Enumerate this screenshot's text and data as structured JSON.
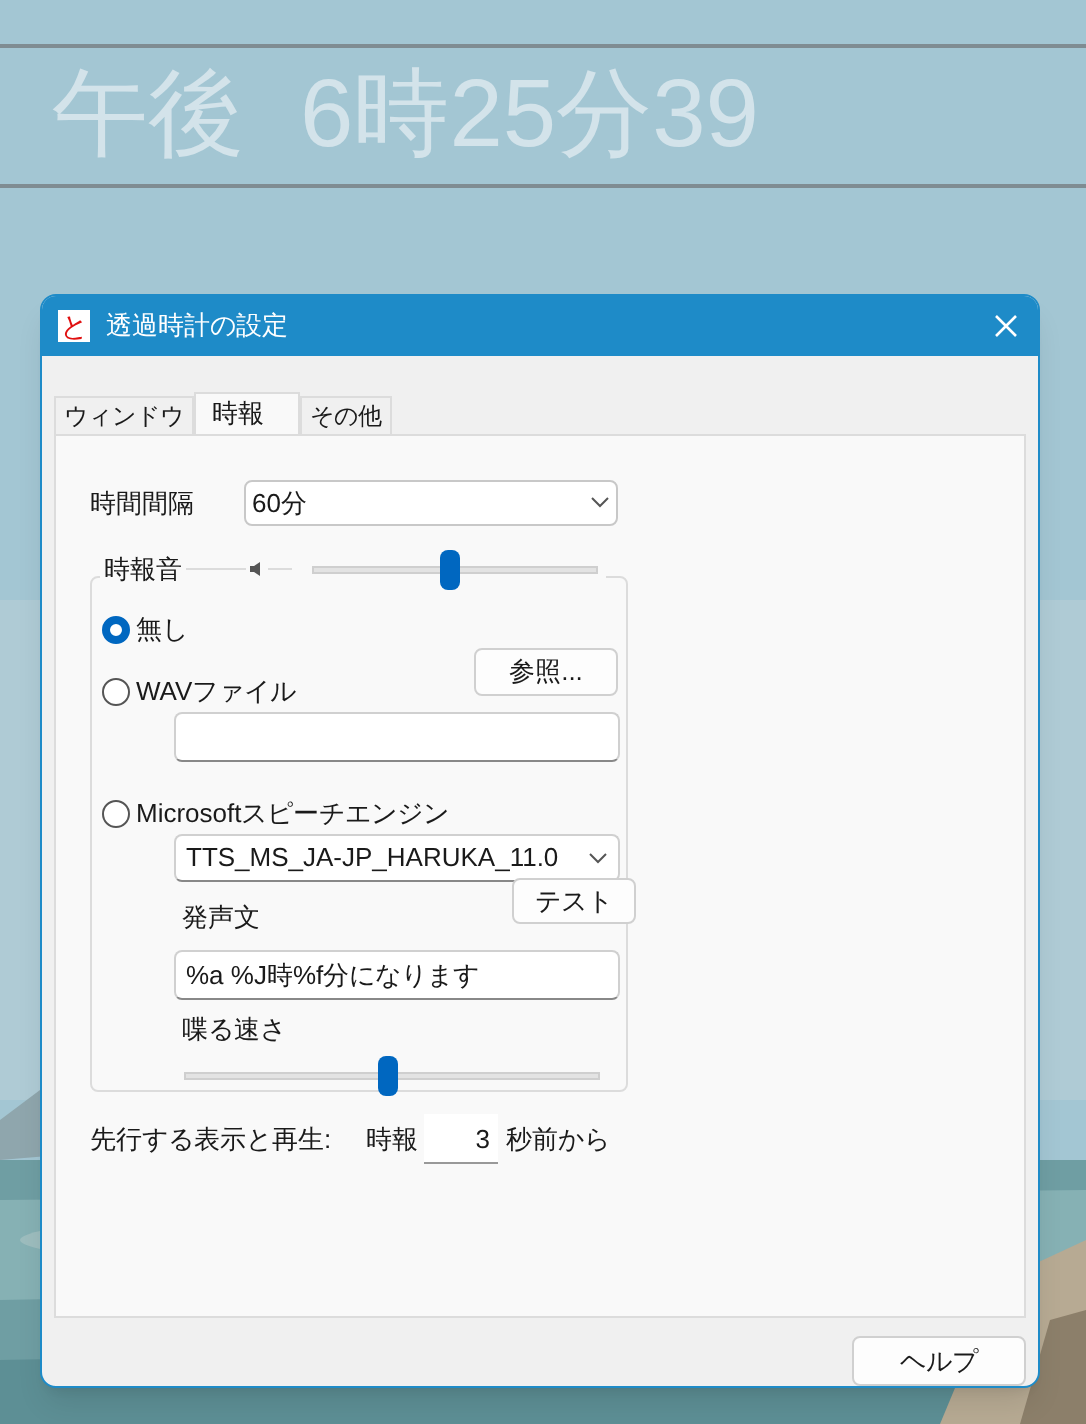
{
  "clock": {
    "period": "午後",
    "time": "6時25分39"
  },
  "window": {
    "title": "透過時計の設定",
    "app_icon": "と"
  },
  "tabs": [
    {
      "label": "ウィンドウ",
      "selected": false
    },
    {
      "label": "時報",
      "selected": true
    },
    {
      "label": "その他",
      "selected": false
    }
  ],
  "interval": {
    "label": "時間間隔",
    "value": "60分"
  },
  "chime": {
    "label": "時報音",
    "volume": {
      "level": 0.48
    },
    "options": [
      {
        "kind": "none",
        "label": "無し",
        "selected": true
      },
      {
        "kind": "wav",
        "label": "WAVファイル",
        "selected": false,
        "browse_button": "参照..."
      },
      {
        "kind": "speech",
        "label": "Microsoftスピーチエンジン",
        "selected": false,
        "voice": "TTS_MS_JA-JP_HARUKA_11.0",
        "text_label": "発声文",
        "test_button": "テスト",
        "text": "%a %J時%f分になります",
        "speed_label": "喋る速さ",
        "speed": {
          "level": 0.49
        }
      }
    ]
  },
  "lead": {
    "label": "先行する表示と再生:",
    "prefix": "時報",
    "value": "3",
    "suffix": "秒前から"
  },
  "help_button": "ヘルプ"
}
